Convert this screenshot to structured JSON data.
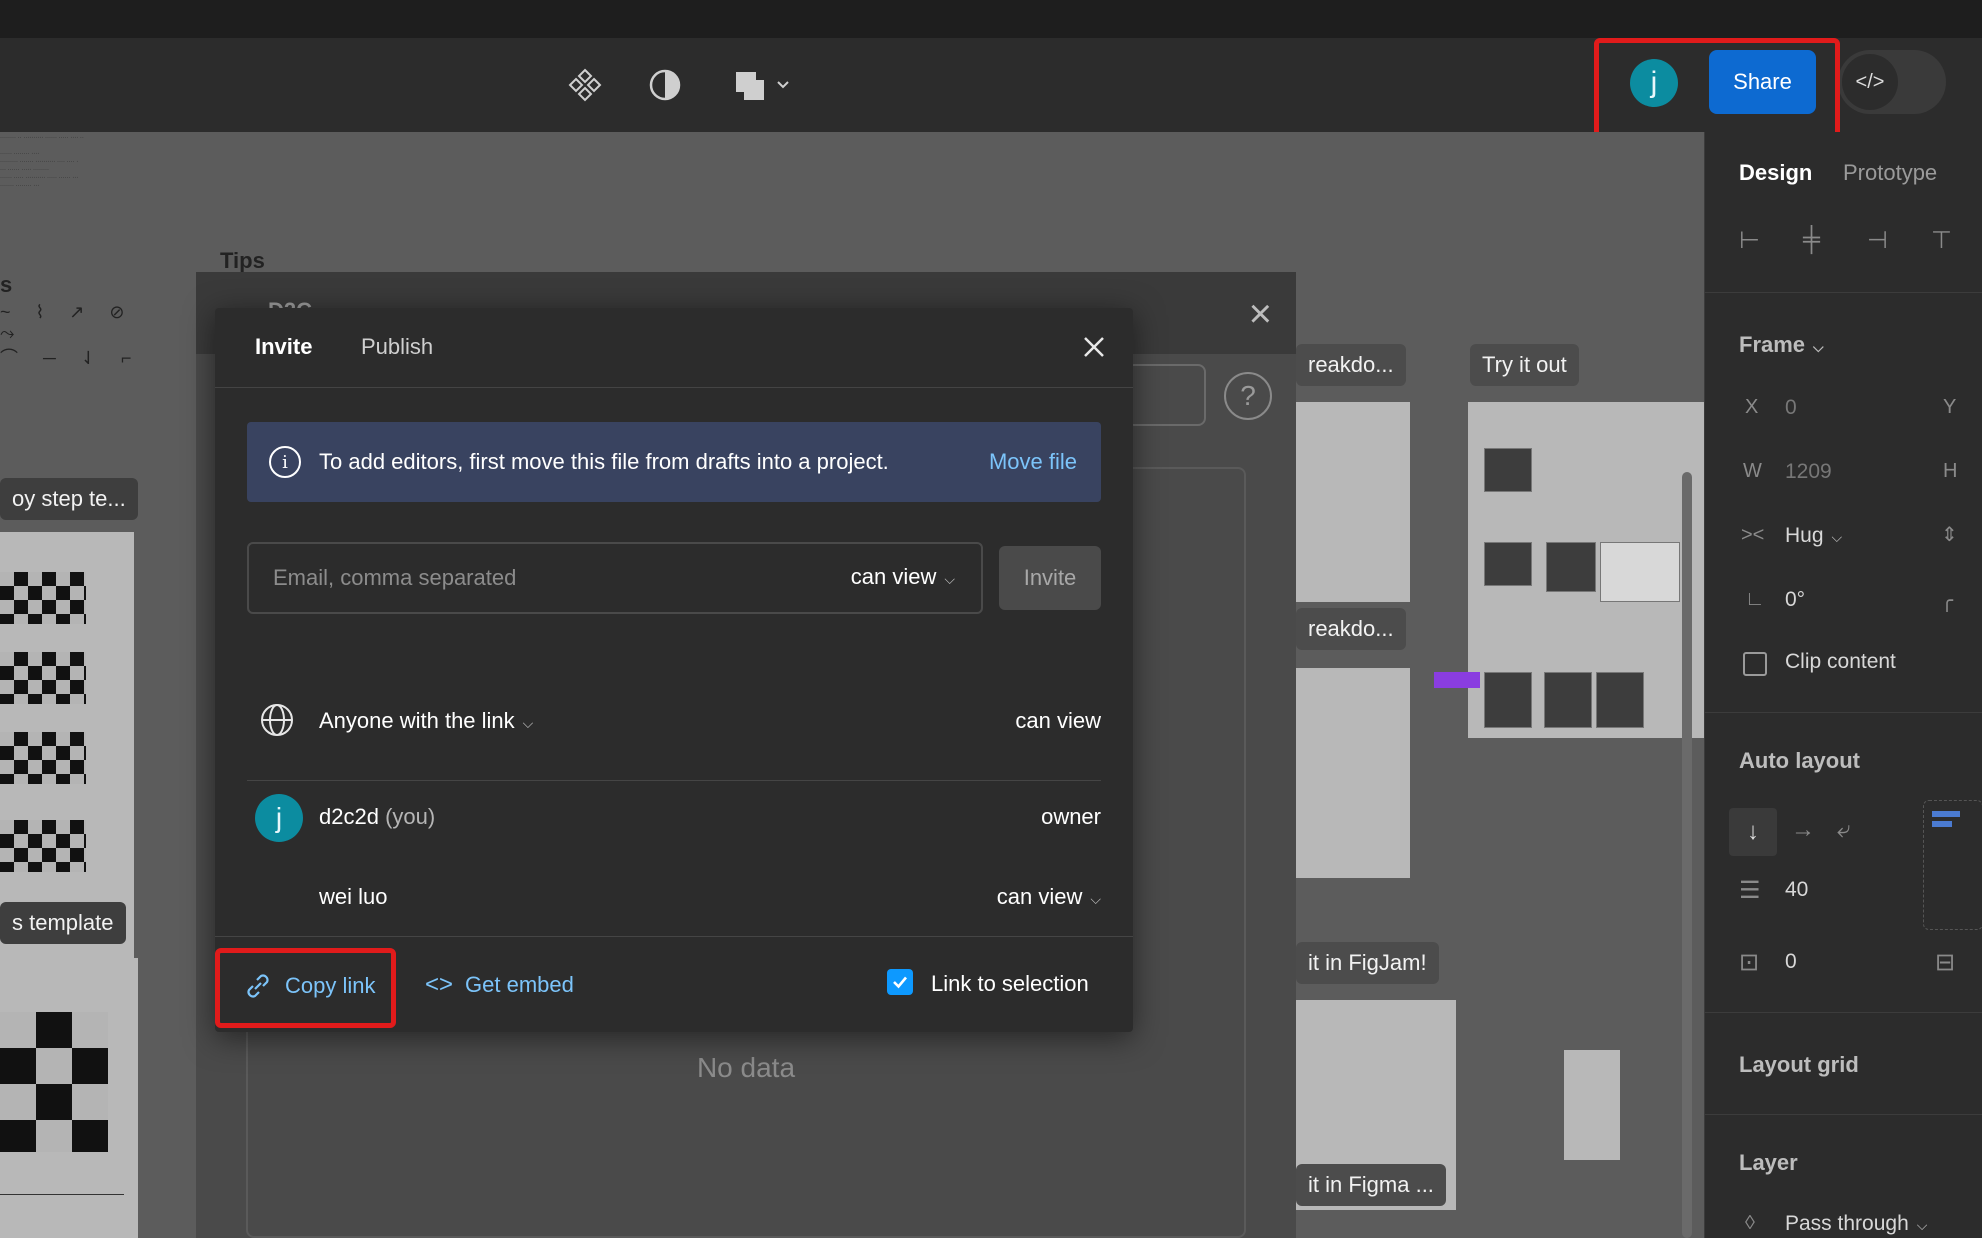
{
  "toolbar": {
    "avatar_initial": "j",
    "share_label": "Share",
    "dev_mode_icon": "code-icon"
  },
  "canvas": {
    "labels": {
      "tips": "Tips",
      "step_te": "oy step te...",
      "template": "s template",
      "breakdown1": "reakdo...",
      "breakdown2": "reakdo...",
      "try_it_out": "Try it out",
      "in_figjam": "it in FigJam!",
      "in_figma": "it in Figma ..."
    }
  },
  "plugin_dialog": {
    "title": "D2C...",
    "no_data": "No data"
  },
  "share_modal": {
    "tabs": [
      "Invite",
      "Publish"
    ],
    "banner": {
      "text": "To add editors, first move this file from drafts into a project.",
      "action": "Move file"
    },
    "email": {
      "placeholder": "Email, comma separated",
      "permission": "can view"
    },
    "invite_label": "Invite",
    "link_access": {
      "label": "Anyone with the link",
      "permission": "can view"
    },
    "members": [
      {
        "initial": "j",
        "name": "d2c2d",
        "suffix": "(you)",
        "role": "owner"
      },
      {
        "name": "wei luo",
        "role": "can view"
      }
    ],
    "footer": {
      "copy_link": "Copy link",
      "get_embed": "Get embed",
      "link_to_selection": "Link to selection",
      "link_to_selection_checked": true
    }
  },
  "properties": {
    "tabs": [
      "Design",
      "Prototype"
    ],
    "frame": {
      "title": "Frame",
      "x_label": "X",
      "x_value": "0",
      "y_label": "Y",
      "w_label": "W",
      "w_value": "1209",
      "h_label": "H",
      "resize": "Hug",
      "rotation": "0°",
      "clip_content": "Clip content"
    },
    "auto_layout": {
      "title": "Auto layout",
      "gap": "40",
      "padding": "0"
    },
    "layout_grid": "Layout grid",
    "layer": {
      "title": "Layer",
      "blend": "Pass through"
    }
  },
  "colors": {
    "accent": "#0d6ad1",
    "link": "#7cc4fa",
    "avatar": "#0c8ca0",
    "highlight": "#e11b1b",
    "banner": "#394360"
  }
}
